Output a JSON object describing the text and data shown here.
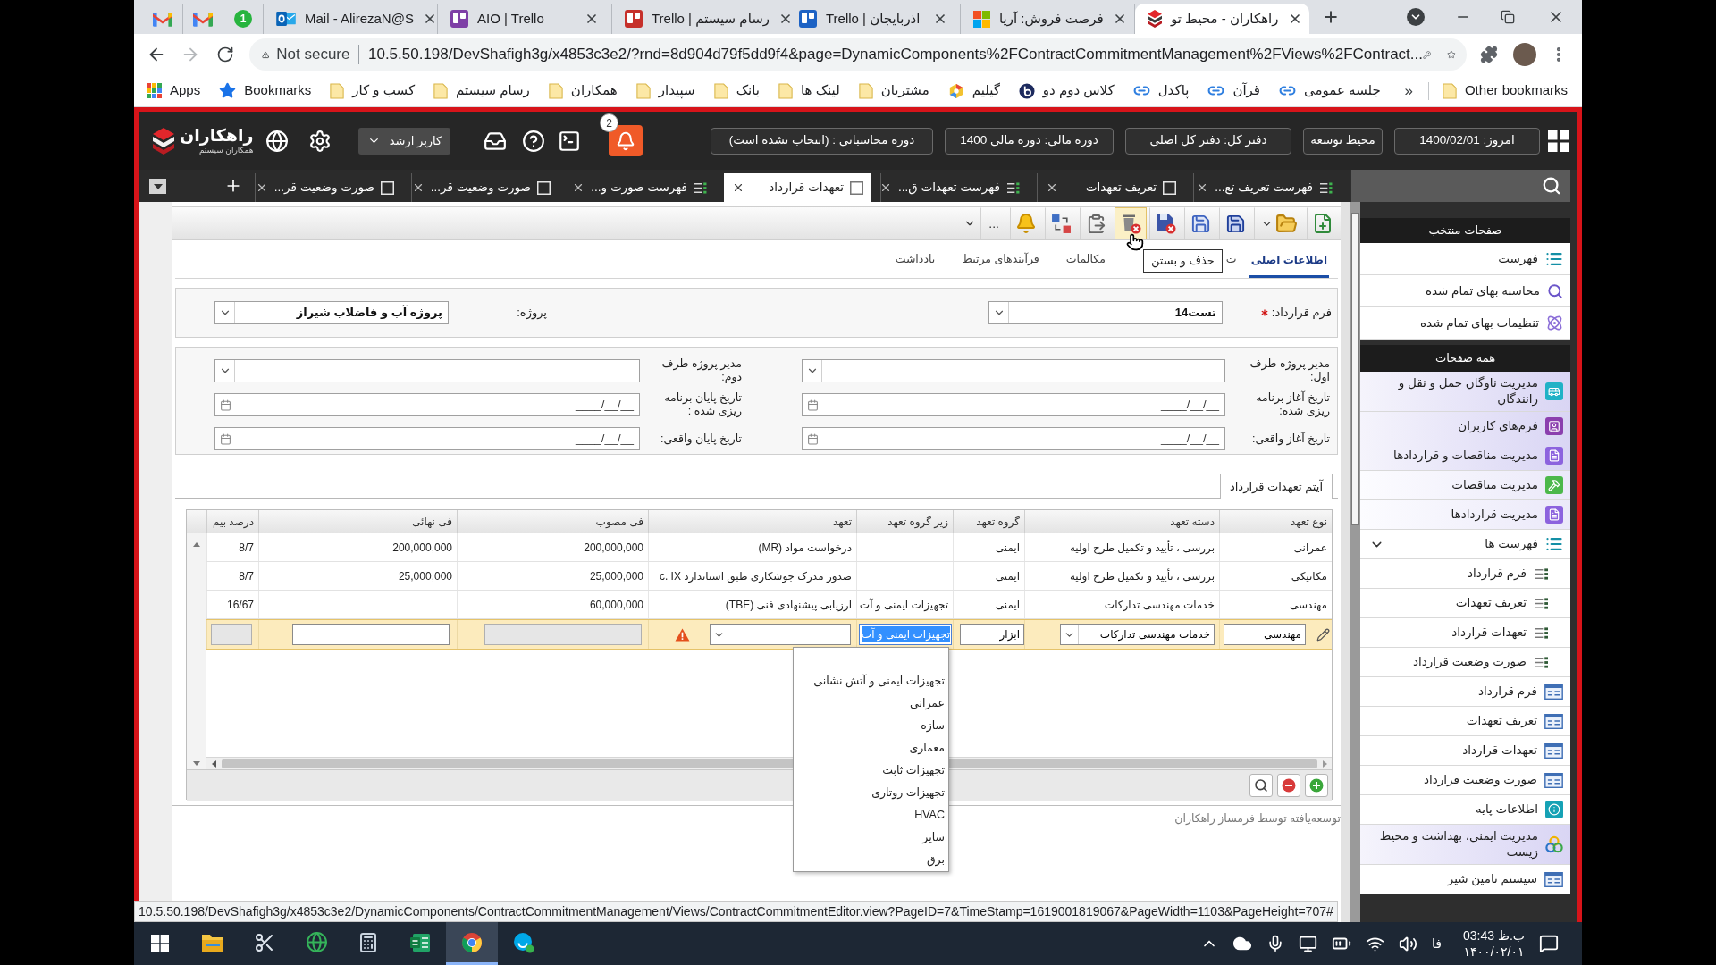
{
  "browser": {
    "tabs": [
      {
        "kind": "app",
        "title": "راهکاران - محیط تو",
        "selected": true
      },
      {
        "kind": "squares",
        "title": "فرصت فروش: آریا",
        "selected": false
      },
      {
        "kind": "board",
        "title": "Trello | اذربایجان",
        "color": "#1d62c4",
        "selected": false
      },
      {
        "kind": "board",
        "title": "Trello | رسام سیستم",
        "color": "#c6302b",
        "selected": false
      },
      {
        "kind": "board",
        "title": "AIO | Trello",
        "color": "#7e3fa6",
        "selected": false
      },
      {
        "kind": "mailbox",
        "title": "Mail - AlirezaN@S",
        "selected": false
      },
      {
        "kind": "chat",
        "badge": "1",
        "selected": false
      },
      {
        "kind": "mail",
        "selected": false
      },
      {
        "kind": "mail",
        "selected": false
      }
    ],
    "security": "Not secure",
    "url": "10.5.50.198/DevShafigh3g/x4853c3e2/?rnd=8d904d79f5dd9f4&page=DynamicComponents%2FContractCommitmentManagement%2FViews%2FContract...",
    "bookmarks": [
      {
        "kind": "link",
        "label": "جلسه عمومی"
      },
      {
        "kind": "link",
        "label": "قرآن"
      },
      {
        "kind": "link",
        "label": "پاکدل"
      },
      {
        "kind": "circle",
        "label": "کلاس دوم دو"
      },
      {
        "kind": "hexagon",
        "label": "گیلیم"
      },
      {
        "kind": "folder",
        "label": "مشتریان"
      },
      {
        "kind": "folder",
        "label": "لینک ها"
      },
      {
        "kind": "folder",
        "label": "بانک"
      },
      {
        "kind": "folder",
        "label": "سپیدار"
      },
      {
        "kind": "folder",
        "label": "همکاران"
      },
      {
        "kind": "folder",
        "label": "رسام سیستم"
      },
      {
        "kind": "folder",
        "label": "کسب و کار"
      },
      {
        "kind": "star",
        "label": "Bookmarks"
      },
      {
        "kind": "apps",
        "label": "Apps"
      }
    ],
    "more_bookmarks": "»",
    "other_bookmarks": "Other bookmarks",
    "status_url": "10.5.50.198/DevShafigh3g/x4853c3e2/DynamicComponents/ContractCommitmentManagement/Views/ContractCommitmentEditor.view?PageID=7&TimeStamp=1619001819067&PageWidth=1103&PageHeight=707#"
  },
  "app": {
    "logo": {
      "name": "راهکاران",
      "tagline": "همکاران سیستم"
    },
    "user": "کاربر ارشد",
    "notification_count": "2",
    "context": [
      "امروز: 1400/02/01",
      "محیط توسعه",
      "دفتر کل: دفتر کل اصلی",
      "دوره مالی: دوره مالی 1400",
      "دوره محاسباتی : (انتخاب نشده است)"
    ],
    "tabs": [
      {
        "kind": "list",
        "title": "فهرست تعریف تع...",
        "selected": false
      },
      {
        "kind": "form",
        "title": "تعریف تعهدات",
        "selected": false
      },
      {
        "kind": "list",
        "title": "فهرست تعهدات ق...",
        "selected": false
      },
      {
        "kind": "form",
        "title": "تعهدات قرارداد",
        "selected": true
      },
      {
        "kind": "list",
        "title": "فهرست صورت و...",
        "selected": false
      },
      {
        "kind": "form",
        "title": "صورت وضعیت قر...",
        "selected": false
      },
      {
        "kind": "form",
        "title": "صورت وضعیت قر...",
        "selected": false
      }
    ],
    "toolbar": [
      {
        "kind": "new",
        "hovered": false
      },
      {
        "kind": "open",
        "hovered": false
      },
      {
        "kind": "save",
        "hovered": false
      },
      {
        "kind": "save-new",
        "hovered": false
      },
      {
        "kind": "save-close",
        "hovered": false
      },
      {
        "kind": "delete-close",
        "hovered": true
      },
      {
        "kind": "paste",
        "hovered": false
      },
      {
        "kind": "swap",
        "hovered": false
      },
      {
        "kind": "alert",
        "hovered": false
      },
      {
        "kind": "more",
        "label": "...",
        "hovered": false
      }
    ],
    "tooltip": "حذف و بستن",
    "subtabs": [
      {
        "label": "اطلاعات اصلی",
        "selected": true
      },
      {
        "label": "ت",
        "selected": false
      },
      {
        "label": "مکالمات",
        "selected": false
      },
      {
        "label": "فرآیندهای مرتبط",
        "selected": false
      },
      {
        "label": "یادداشت",
        "selected": false
      }
    ],
    "header_fields": [
      {
        "label": "فرم قرارداد:",
        "required": true,
        "value": "تست14"
      },
      {
        "label": "پروژه:",
        "required": false,
        "value": "پروژه آب و فاضلاب شیراز"
      }
    ],
    "fields": [
      {
        "kind": "select",
        "label": "مدیر پروژه طرف اول:"
      },
      {
        "kind": "select",
        "label": "مدیر پروژه طرف دوم:"
      },
      {
        "kind": "date",
        "label": "تاریخ آغاز برنامه ریزی شده:",
        "placeholder": "____/__/__"
      },
      {
        "kind": "date",
        "label": "تاریخ پایان برنامه ریزی شده :",
        "placeholder": "____/__/__"
      },
      {
        "kind": "date",
        "label": "تاریخ آغاز واقعی:",
        "placeholder": "____/__/__"
      },
      {
        "kind": "date",
        "label": "تاریخ پایان واقعی:",
        "placeholder": "____/__/__"
      }
    ],
    "grid": {
      "tab": "آیتم تعهدات قرارداد",
      "columns": [
        "نوع تعهد",
        "دسته تعهد",
        "گروه تعهد",
        "زیر گروه تعهد",
        "تعهد",
        "فی مصوب",
        "فی نهائی",
        "درصد بیم"
      ],
      "rows": [
        [
          "عمرانی",
          "بررسی ، تأیید و تکمیل طرح اولیه",
          "ایمنی",
          null,
          "درخواست مواد (MR)",
          "200,000,000",
          "200,000,000",
          "8/7"
        ],
        [
          "مکانیکی",
          "بررسی ، تأیید و تکمیل طرح اولیه",
          "ایمنی",
          null,
          "صدور مدرک جوشکاری طبق استاندارد c. IX",
          "25,000,000",
          "25,000,000",
          "8/7"
        ],
        [
          "مهندسی",
          "خدمات مهندسی تدارکات",
          "ایمنی",
          "تجهیزات ایمنی و آت",
          "ارزیابی پیشنهادی فنی (TBE)",
          "60,000,000",
          null,
          "16/67"
        ]
      ],
      "edit_row": [
        {
          "kind": "input",
          "value": "مهندسی"
        },
        {
          "kind": "select",
          "value": "خدمات مهندسی تدارکات"
        },
        {
          "kind": "input",
          "value": "ابزار"
        },
        {
          "kind": "selected-input",
          "value": "تجهیزات ایمنی و آت"
        },
        {
          "kind": "invalid-select"
        },
        {
          "kind": "disabled"
        },
        {
          "kind": "input"
        },
        {
          "kind": "disabled"
        }
      ],
      "dropdown": [
        "تجهیزات ایمنی و آتش نشانی",
        "عمرانی",
        "سازه",
        "معماری",
        "تجهیزات ثابت",
        "تجهیزات روتاری",
        "HVAC",
        "سایر",
        "برق"
      ]
    },
    "footer": "توسعه‌یافته توسط فرمساز راهکاران"
  },
  "sidebar": {
    "favorites_title": "صفحات منتخب",
    "favorites": [
      {
        "kind": "listing",
        "label": "فهرست"
      },
      {
        "kind": "calculation",
        "label": "محاسبه بهای تمام شده"
      },
      {
        "kind": "settings",
        "label": "تنظیمات بهای تمام شده"
      }
    ],
    "all_title": "همه صفحات",
    "items": [
      {
        "kind": "fleet",
        "label": "مدیریت ناوگان حمل و نقل و رانندگان"
      },
      {
        "kind": "forms",
        "label": "فرم‌های کاربران"
      },
      {
        "kind": "procurement",
        "label": "مدیریت مناقصات و قراردادها"
      },
      {
        "kind": "tenders",
        "label": "مدیریت مناقصات"
      },
      {
        "kind": "contracts",
        "label": "مدیریت قراردادها"
      },
      {
        "kind": "lists",
        "label": "فهرست ها",
        "expanded": true,
        "children": [
          {
            "kind": "report",
            "label": "فرم قرارداد"
          },
          {
            "kind": "report",
            "label": "تعریف تعهدات"
          },
          {
            "kind": "report",
            "label": "تعهدات قرارداد"
          },
          {
            "kind": "report",
            "label": "صورت وضعیت قرارداد"
          }
        ]
      },
      {
        "kind": "form",
        "label": "فرم قرارداد"
      },
      {
        "kind": "form",
        "label": "تعریف تعهدات"
      },
      {
        "kind": "form",
        "label": "تعهدات قرارداد"
      },
      {
        "kind": "form",
        "label": "صورت وضعیت قرارداد"
      },
      {
        "kind": "basics",
        "label": "اطلاعات پایه"
      },
      {
        "kind": "safety",
        "label": "مدیریت ایمنی، بهداشت و محیط زیست"
      },
      {
        "kind": "form",
        "label": "سیستم تامین شیر"
      }
    ]
  },
  "taskbar": {
    "apps": [
      {
        "kind": "files",
        "selected": false
      },
      {
        "kind": "snip",
        "selected": false
      },
      {
        "kind": "globe",
        "selected": false
      },
      {
        "kind": "calculator",
        "selected": false
      },
      {
        "kind": "sheet",
        "selected": false
      },
      {
        "kind": "browser",
        "selected": true
      },
      {
        "kind": "chat",
        "selected": false
      }
    ],
    "language": "فا",
    "time": "ب.ظ 03:43",
    "date": "۱۴۰۰/۰۲/۰۱"
  }
}
